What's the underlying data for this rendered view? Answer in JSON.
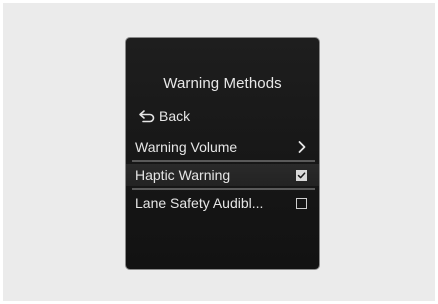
{
  "screen": {
    "title": "Warning Methods",
    "back_label": "Back",
    "items": [
      {
        "label": "Warning Volume",
        "control": "chevron-right-icon"
      },
      {
        "label": "Haptic Warning",
        "control": "checkbox",
        "checked": true
      },
      {
        "label": "Lane Safety Audibl...",
        "control": "checkbox",
        "checked": false
      }
    ]
  },
  "colors": {
    "background": "#ebebeb",
    "screen": "#1a1a1a",
    "text": "#e6e6e6",
    "divider": "#5a5a5a"
  }
}
